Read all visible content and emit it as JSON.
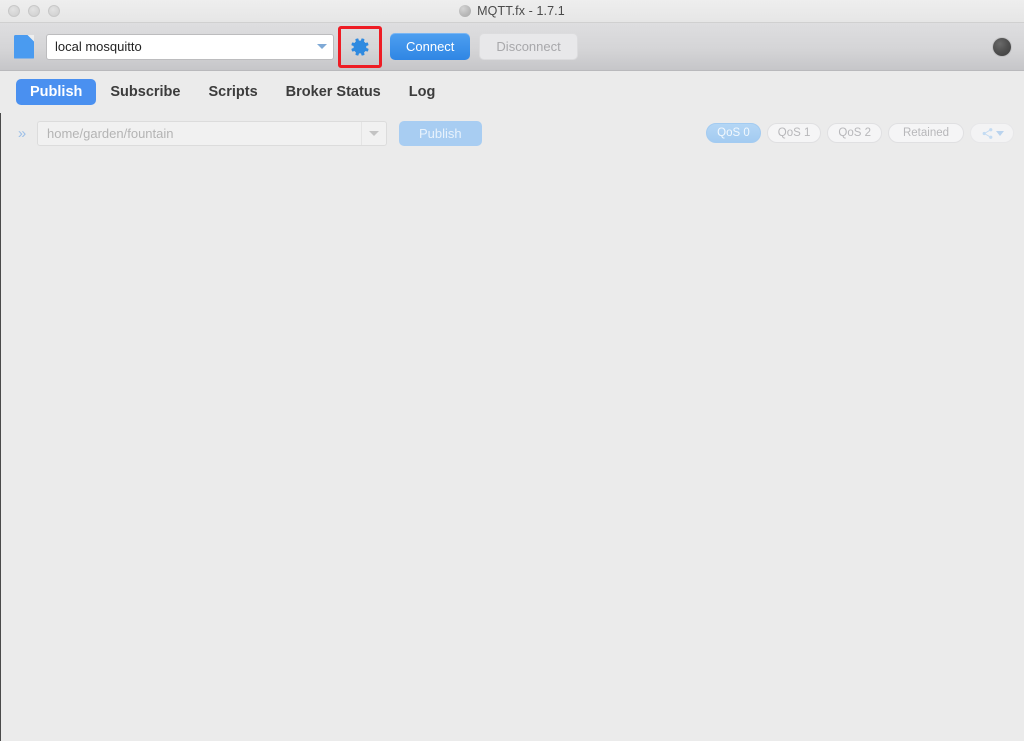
{
  "window": {
    "title": "MQTT.fx - 1.7.1",
    "title_icon": "globe-icon",
    "traffic_lights": [
      "close",
      "minimize",
      "zoom"
    ]
  },
  "toolbar": {
    "file_icon": "file-icon",
    "broker_combo": {
      "value": "local mosquitto",
      "arrow_icon": "chevron-down-icon"
    },
    "settings_icon": "gear-icon",
    "connect_label": "Connect",
    "disconnect_label": "Disconnect",
    "status_indicator": "connection-status-dot",
    "highlight_color": "#ee1c24",
    "connect_color": "#3b8fea"
  },
  "tabs": [
    {
      "label": "Publish",
      "active": true
    },
    {
      "label": "Subscribe",
      "active": false
    },
    {
      "label": "Scripts",
      "active": false
    },
    {
      "label": "Broker Status",
      "active": false
    },
    {
      "label": "Log",
      "active": false
    }
  ],
  "publish": {
    "expand_icon": "double-chevron-right-icon",
    "topic": {
      "value": "",
      "placeholder": "home/garden/fountain",
      "arrow_icon": "chevron-down-icon"
    },
    "publish_button": "Publish",
    "qos": [
      {
        "label": "QoS 0",
        "selected": true
      },
      {
        "label": "QoS 1",
        "selected": false
      },
      {
        "label": "QoS 2",
        "selected": false
      }
    ],
    "retained_label": "Retained",
    "share_icon": "share-nodes-icon",
    "share_arrow_icon": "chevron-down-icon"
  },
  "colors": {
    "background": "#ebebeb",
    "toolbar_top": "#dedee0",
    "toolbar_bottom": "#c6c6c9",
    "accent_blue": "#4a90f0"
  }
}
